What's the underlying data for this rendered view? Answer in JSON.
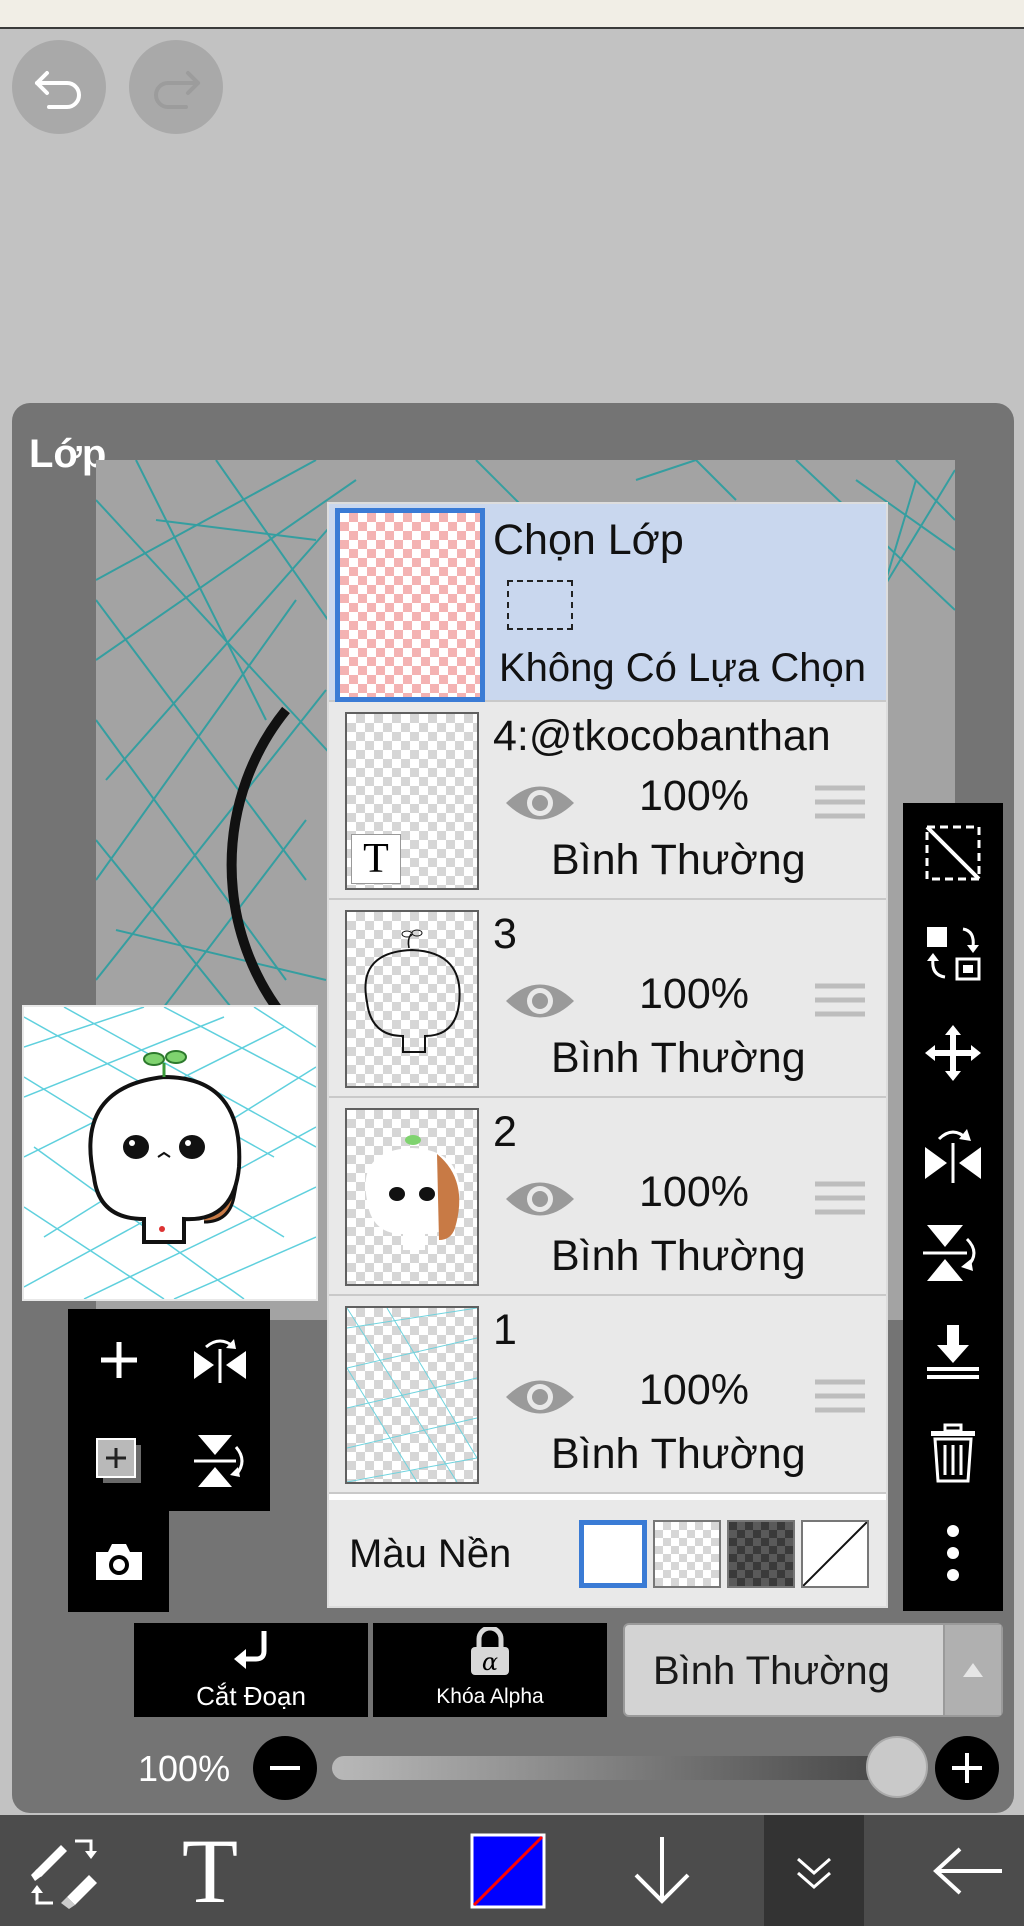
{
  "panel": {
    "title": "Lớp"
  },
  "selection_row": {
    "title": "Chọn Lớp",
    "subtitle": "Không Có Lựa Chọn"
  },
  "layers": [
    {
      "name": "4:@tkocobanthan",
      "opacity": "100%",
      "blend": "Bình Thường",
      "visible": true,
      "thumb": "text-layer",
      "thumb_glyph": "T"
    },
    {
      "name": "3",
      "opacity": "100%",
      "blend": "Bình Thường",
      "visible": true,
      "thumb": "lineart"
    },
    {
      "name": "2",
      "opacity": "100%",
      "blend": "Bình Thường",
      "visible": true,
      "thumb": "color"
    },
    {
      "name": "1",
      "opacity": "100%",
      "blend": "Bình Thường",
      "visible": true,
      "thumb": "sketch"
    }
  ],
  "background": {
    "label": "Màu Nền",
    "options": [
      "white",
      "transparent",
      "dark-checker",
      "diagonal"
    ],
    "selected": "white"
  },
  "actions": {
    "clipping_label": "Cắt Đoạn",
    "alpha_lock_label": "Khóa Alpha",
    "blend_mode": "Bình Thường"
  },
  "opacity": {
    "label": "100%",
    "value_fraction": 1.0
  },
  "bottom_bar": {
    "items": [
      "pen-eraser-swap-icon",
      "text-tool-icon",
      "color-swatch",
      "arrow-down-icon",
      "collapse-icon",
      "back-arrow-icon"
    ],
    "text_glyph": "T",
    "colors": {
      "primary": "#0000ff",
      "secondary": "#ff0000"
    }
  },
  "colors": {
    "panel_bg": "#747474",
    "selected_row": "#c9d7ee",
    "accent": "#3a7bd5",
    "sketch_line": "#2a9ea0"
  }
}
